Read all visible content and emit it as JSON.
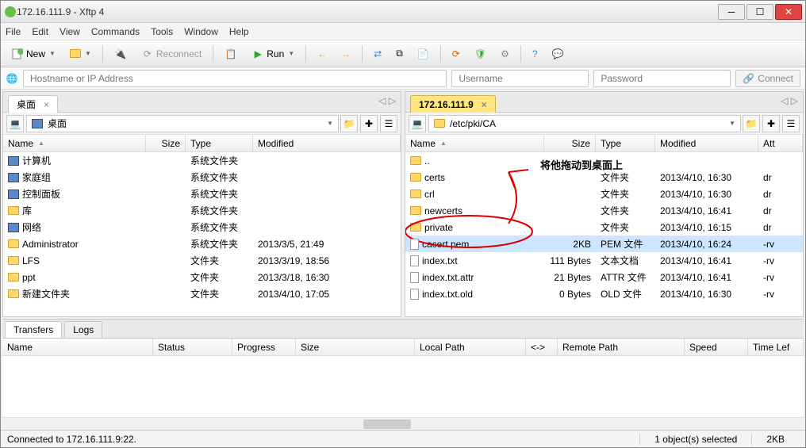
{
  "window": {
    "title": "172.16.111.9 - Xftp 4"
  },
  "menu": {
    "file": "File",
    "edit": "Edit",
    "view": "View",
    "commands": "Commands",
    "tools": "Tools",
    "window": "Window",
    "help": "Help"
  },
  "toolbar": {
    "newLabel": "New",
    "reconnect": "Reconnect",
    "run": "Run"
  },
  "quick": {
    "hostPh": "Hostname or IP Address",
    "userPh": "Username",
    "passPh": "Password",
    "connect": "Connect"
  },
  "leftPane": {
    "tab": "桌面",
    "path": "桌面",
    "headers": {
      "name": "Name",
      "size": "Size",
      "type": "Type",
      "modified": "Modified"
    },
    "rows": [
      {
        "icon": "comp",
        "name": "计算机",
        "size": "",
        "type": "系统文件夹",
        "modified": ""
      },
      {
        "icon": "comp",
        "name": "家庭组",
        "size": "",
        "type": "系统文件夹",
        "modified": ""
      },
      {
        "icon": "comp",
        "name": "控制面板",
        "size": "",
        "type": "系统文件夹",
        "modified": ""
      },
      {
        "icon": "folder",
        "name": "库",
        "size": "",
        "type": "系统文件夹",
        "modified": ""
      },
      {
        "icon": "comp",
        "name": "网络",
        "size": "",
        "type": "系统文件夹",
        "modified": ""
      },
      {
        "icon": "folder",
        "name": "Administrator",
        "size": "",
        "type": "系统文件夹",
        "modified": "2013/3/5, 21:49"
      },
      {
        "icon": "folder",
        "name": "LFS",
        "size": "",
        "type": "文件夹",
        "modified": "2013/3/19, 18:56"
      },
      {
        "icon": "folder",
        "name": "ppt",
        "size": "",
        "type": "文件夹",
        "modified": "2013/3/18, 16:30"
      },
      {
        "icon": "folder",
        "name": "新建文件夹",
        "size": "",
        "type": "文件夹",
        "modified": "2013/4/10, 17:05"
      }
    ]
  },
  "rightPane": {
    "tab": "172.16.111.9",
    "path": "/etc/pki/CA",
    "headers": {
      "name": "Name",
      "size": "Size",
      "type": "Type",
      "modified": "Modified",
      "att": "Att"
    },
    "rows": [
      {
        "icon": "folder",
        "name": "..",
        "size": "",
        "type": "",
        "modified": "",
        "att": ""
      },
      {
        "icon": "folder",
        "name": "certs",
        "size": "",
        "type": "文件夹",
        "modified": "2013/4/10, 16:30",
        "att": "dr"
      },
      {
        "icon": "folder",
        "name": "crl",
        "size": "",
        "type": "文件夹",
        "modified": "2013/4/10, 16:30",
        "att": "dr"
      },
      {
        "icon": "folder",
        "name": "newcerts",
        "size": "",
        "type": "文件夹",
        "modified": "2013/4/10, 16:41",
        "att": "dr"
      },
      {
        "icon": "folder",
        "name": "private",
        "size": "",
        "type": "文件夹",
        "modified": "2013/4/10, 16:15",
        "att": "dr"
      },
      {
        "icon": "file",
        "name": "cacert.pem",
        "size": "2KB",
        "type": "PEM 文件",
        "modified": "2013/4/10, 16:24",
        "att": "-rv",
        "sel": true
      },
      {
        "icon": "file",
        "name": "index.txt",
        "size": "111 Bytes",
        "type": "文本文档",
        "modified": "2013/4/10, 16:41",
        "att": "-rv"
      },
      {
        "icon": "file",
        "name": "index.txt.attr",
        "size": "21 Bytes",
        "type": "ATTR 文件",
        "modified": "2013/4/10, 16:41",
        "att": "-rv"
      },
      {
        "icon": "file",
        "name": "index.txt.old",
        "size": "0 Bytes",
        "type": "OLD 文件",
        "modified": "2013/4/10, 16:30",
        "att": "-rv"
      }
    ],
    "annotation": "将他拖动到桌面上"
  },
  "transfers": {
    "tabs": {
      "transfers": "Transfers",
      "logs": "Logs"
    },
    "headers": {
      "name": "Name",
      "status": "Status",
      "progress": "Progress",
      "size": "Size",
      "localPath": "Local Path",
      "arrow": "<->",
      "remotePath": "Remote Path",
      "speed": "Speed",
      "timeLeft": "Time Lef"
    }
  },
  "status": {
    "left": "Connected to 172.16.111.9:22.",
    "mid": "1 object(s) selected",
    "right": "2KB"
  }
}
